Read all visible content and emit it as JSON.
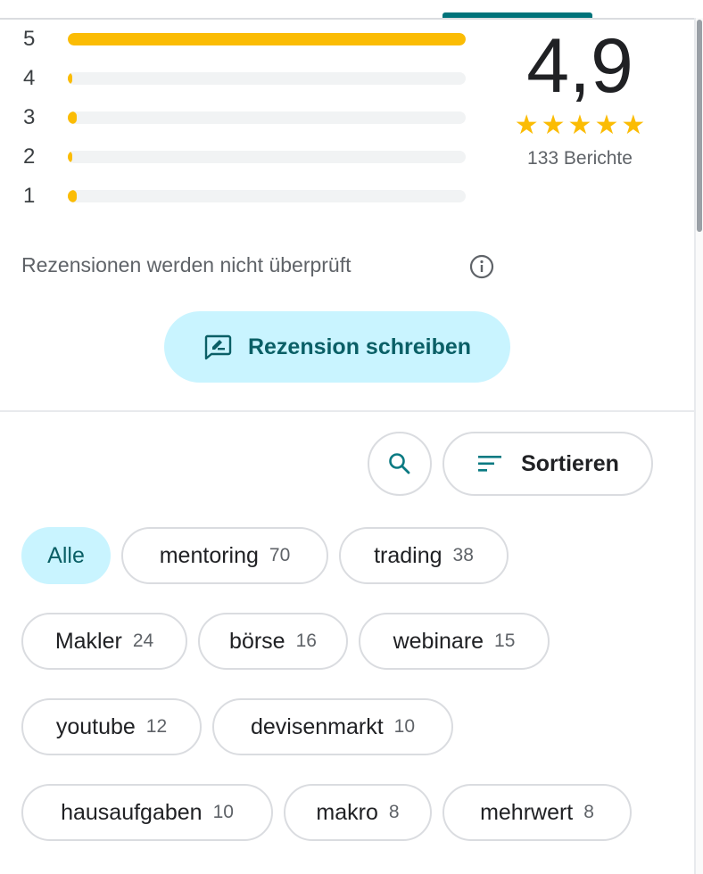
{
  "histogram": [
    {
      "stars": "5",
      "fraction": 1.0
    },
    {
      "stars": "4",
      "fraction": 0.0
    },
    {
      "stars": "3",
      "fraction": 0.02
    },
    {
      "stars": "2",
      "fraction": 0.0
    },
    {
      "stars": "1",
      "fraction": 0.02
    }
  ],
  "summary": {
    "rating": "4,9",
    "stars_filled": 5,
    "count_label": "133 Berichte"
  },
  "notice": {
    "text": "Rezensionen werden nicht überprüft",
    "icon": "info-icon"
  },
  "write_review": {
    "label": "Rezension schreiben",
    "icon": "rate-review-icon"
  },
  "toolbar": {
    "search_icon": "search-icon",
    "sort_label": "Sortieren",
    "sort_icon": "sort-icon"
  },
  "chips": [
    {
      "label": "Alle",
      "count": "",
      "active": true
    },
    {
      "label": "mentoring",
      "count": "70"
    },
    {
      "label": "trading",
      "count": "38"
    },
    {
      "label": "Makler",
      "count": "24"
    },
    {
      "label": "börse",
      "count": "16"
    },
    {
      "label": "webinare",
      "count": "15"
    },
    {
      "label": "youtube",
      "count": "12"
    },
    {
      "label": "devisenmarkt",
      "count": "10"
    },
    {
      "label": "hausaufgaben",
      "count": "10"
    },
    {
      "label": "makro",
      "count": "8"
    },
    {
      "label": "mehrwert",
      "count": "8"
    }
  ],
  "colors": {
    "star": "#fbbc04",
    "accent_bg": "#c9f4ff",
    "accent_text": "#0a5f66",
    "tab_indicator": "#00737a"
  }
}
